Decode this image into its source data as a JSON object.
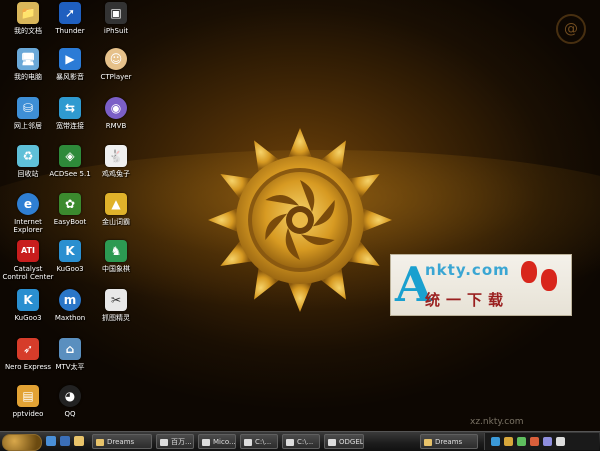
{
  "desktop_icons": [
    {
      "label": "我的文档",
      "icon": "folder-documents-icon",
      "color": "#d9b65a",
      "glyph": "📁"
    },
    {
      "label": "Thunder",
      "icon": "thunder-bird-icon",
      "color": "#1f5fbf",
      "glyph": "➚"
    },
    {
      "label": "iPhSuit",
      "icon": "phone-icon",
      "color": "#333333",
      "glyph": "▣"
    },
    {
      "label": "我的电脑",
      "icon": "computer-icon",
      "color": "#6aa8d8",
      "glyph": "🖥"
    },
    {
      "label": "暴风影音",
      "icon": "storm-player-icon",
      "color": "#2b7bd6",
      "glyph": "▶"
    },
    {
      "label": "CTPlayer",
      "icon": "player-face-icon",
      "color": "#e6c18a",
      "glyph": "☺"
    },
    {
      "label": "网上邻居",
      "icon": "network-icon",
      "color": "#3e8fd6",
      "glyph": "⛁"
    },
    {
      "label": "宽带连接",
      "icon": "broadband-icon",
      "color": "#2f9ad0",
      "glyph": "⇆"
    },
    {
      "label": "RMVB",
      "icon": "disc-icon",
      "color": "#7b5fc7",
      "glyph": "◉"
    },
    {
      "label": "回收站",
      "icon": "recycle-bin-icon",
      "color": "#5fc0d8",
      "glyph": "♻"
    },
    {
      "label": "ACDSee 5.1",
      "icon": "acdsee-icon",
      "color": "#2e8a3a",
      "glyph": "◈"
    },
    {
      "label": "鸡鸡兔子",
      "icon": "rabbit-icon",
      "color": "#f0f0f0",
      "glyph": "🐇"
    },
    {
      "label": "Internet Explorer",
      "icon": "internet-explorer-icon",
      "color": "#2f7fd3",
      "glyph": "e"
    },
    {
      "label": "EasyBoot",
      "icon": "easyboot-icon",
      "color": "#3b8a2e",
      "glyph": "✿"
    },
    {
      "label": "金山词霸",
      "icon": "dictionary-icon",
      "color": "#e0b22a",
      "glyph": "▲"
    },
    {
      "label": "Catalyst Control Center",
      "icon": "ati-icon",
      "color": "#c81d1d",
      "glyph": "ATI"
    },
    {
      "label": "KuGoo3",
      "icon": "kugoo-icon",
      "color": "#2a8fd0",
      "glyph": "K"
    },
    {
      "label": "中国象棋",
      "icon": "chess-icon",
      "color": "#2c9a52",
      "glyph": "♞"
    },
    {
      "label": "KuGoo3",
      "icon": "kugoo-icon",
      "color": "#2a8fd0",
      "glyph": "K"
    },
    {
      "label": "Maxthon",
      "icon": "maxthon-icon",
      "color": "#2a76c8",
      "glyph": "m"
    },
    {
      "label": "抓图精灵",
      "icon": "capture-icon",
      "color": "#e8e8e8",
      "glyph": "✂"
    },
    {
      "label": "Nero Express",
      "icon": "nero-icon",
      "color": "#d63c2a",
      "glyph": "➶"
    },
    {
      "label": "MTV太平",
      "icon": "mtv-icon",
      "color": "#5a8fbf",
      "glyph": "⌂"
    },
    {
      "label": "pptvideo",
      "icon": "ppt-video-icon",
      "color": "#e2a234",
      "glyph": "▤"
    },
    {
      "label": "QQ",
      "icon": "qq-penguin-icon",
      "color": "#222222",
      "glyph": "◕"
    }
  ],
  "logo": {
    "letter": "A",
    "top": "nkty.com",
    "bottom": "统一下载"
  },
  "watermark": "xz.nkty.com",
  "taskbar": {
    "tasks": [
      "Dreams",
      "百万...",
      "Mico...",
      "C:\\...",
      "C:\\...",
      "ODGEL...",
      "Dreams"
    ],
    "colors": {
      "start": "#c48a2a"
    }
  }
}
